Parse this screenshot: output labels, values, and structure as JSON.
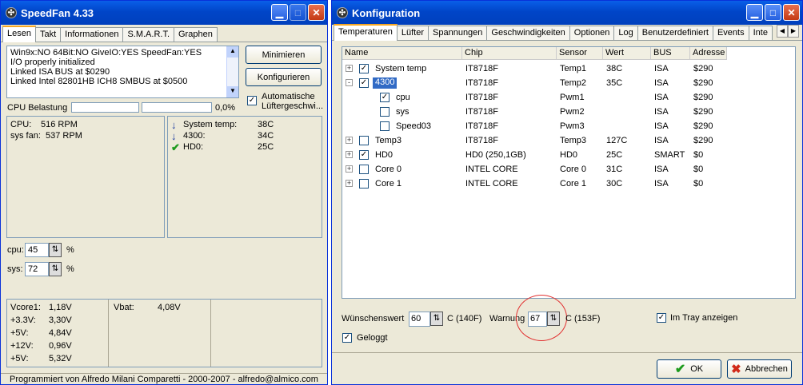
{
  "left": {
    "title": "SpeedFan 4.33",
    "tabs": [
      "Lesen",
      "Takt",
      "Informationen",
      "S.M.A.R.T.",
      "Graphen"
    ],
    "log_lines": [
      "Win9x:NO  64Bit:NO  GiveIO:YES  SpeedFan:YES",
      "I/O properly initialized",
      "Linked ISA BUS at $0290",
      "Linked Intel 82801HB ICH8 SMBUS at $0500"
    ],
    "minimize_label": "Minimieren",
    "configure_label": "Konfigurieren",
    "auto_fan_label_1": "Automatische",
    "auto_fan_label_2": "Lüftergeschwi...",
    "cpu_load_label": "CPU Belastung",
    "cpu_load_percent": "0,0%",
    "cpu_load_value": 0,
    "fans": [
      {
        "name": "CPU:",
        "value": "516 RPM"
      },
      {
        "name": "sys fan:",
        "value": "537 RPM"
      }
    ],
    "temps": [
      {
        "name": "System temp:",
        "value": "38C",
        "icon": "arrow-down-icon"
      },
      {
        "name": "4300:",
        "value": "34C",
        "icon": "arrow-down-icon"
      },
      {
        "name": "HD0:",
        "value": "25C",
        "icon": "check-icon"
      }
    ],
    "speeds": [
      {
        "name": "cpu:",
        "value": "45",
        "unit": "%"
      },
      {
        "name": "sys:",
        "value": "72",
        "unit": "%"
      }
    ],
    "voltages": [
      {
        "name": "Vcore1:",
        "value": "1,18V"
      },
      {
        "name": "+3.3V:",
        "value": "3,30V"
      },
      {
        "name": "+5V:",
        "value": "4,84V"
      },
      {
        "name": "+12V:",
        "value": "0,96V"
      },
      {
        "name": "+5V:",
        "value": "5,32V"
      }
    ],
    "vbat": {
      "name": "Vbat:",
      "value": "4,08V"
    },
    "footer": "Programmiert von Alfredo Milani Comparetti - 2000-2007 - alfredo@almico.com"
  },
  "right": {
    "title": "Konfiguration",
    "tabs": [
      "Temperaturen",
      "Lüfter",
      "Spannungen",
      "Geschwindigkeiten",
      "Optionen",
      "Log",
      "Benutzerdefiniert",
      "Events",
      "Inte"
    ],
    "columns": [
      "Name",
      "Chip",
      "Sensor",
      "Wert",
      "BUS",
      "Adresse"
    ],
    "rows": [
      {
        "name": "System temp",
        "chip": "IT8718F",
        "sensor": "Temp1",
        "value": "38C",
        "bus": "ISA",
        "address": "$290",
        "level": 0,
        "tree": "+",
        "checked": true
      },
      {
        "name": "4300",
        "chip": "IT8718F",
        "sensor": "Temp2",
        "value": "35C",
        "bus": "ISA",
        "address": "$290",
        "level": 0,
        "tree": "-",
        "checked": true,
        "selected": true
      },
      {
        "name": "cpu",
        "chip": "IT8718F",
        "sensor": "Pwm1",
        "value": "",
        "bus": "ISA",
        "address": "$290",
        "level": 1,
        "tree": "",
        "checked": true
      },
      {
        "name": "sys",
        "chip": "IT8718F",
        "sensor": "Pwm2",
        "value": "",
        "bus": "ISA",
        "address": "$290",
        "level": 1,
        "tree": "",
        "checked": false
      },
      {
        "name": "Speed03",
        "chip": "IT8718F",
        "sensor": "Pwm3",
        "value": "",
        "bus": "ISA",
        "address": "$290",
        "level": 1,
        "tree": "",
        "checked": false
      },
      {
        "name": "Temp3",
        "chip": "IT8718F",
        "sensor": "Temp3",
        "value": "127C",
        "bus": "ISA",
        "address": "$290",
        "level": 0,
        "tree": "+",
        "checked": false
      },
      {
        "name": "HD0",
        "chip": "HD0 (250,1GB)",
        "sensor": "HD0",
        "value": "25C",
        "bus": "SMART",
        "address": "$0",
        "level": 0,
        "tree": "+",
        "checked": true
      },
      {
        "name": "Core 0",
        "chip": "INTEL CORE",
        "sensor": "Core 0",
        "value": "31C",
        "bus": "ISA",
        "address": "$0",
        "level": 0,
        "tree": "+",
        "checked": false
      },
      {
        "name": "Core 1",
        "chip": "INTEL CORE",
        "sensor": "Core 1",
        "value": "30C",
        "bus": "ISA",
        "address": "$0",
        "level": 0,
        "tree": "+",
        "checked": false
      }
    ],
    "desired_label": "Wünschenswert",
    "desired_value": "60",
    "desired_unit": "C (140F)",
    "warning_label": "Warnung",
    "warning_value": "67",
    "warning_unit": "C (153F)",
    "tray_label": "Im Tray anzeigen",
    "tray_checked": true,
    "logged_label": "Geloggt",
    "logged_checked": true,
    "ok_label": "OK",
    "cancel_label": "Abbrechen"
  }
}
